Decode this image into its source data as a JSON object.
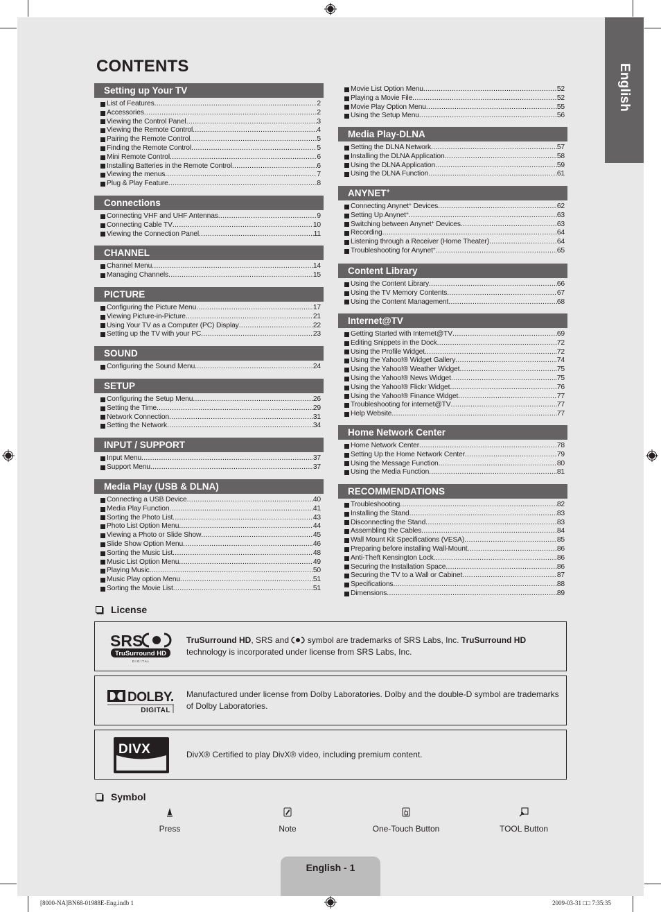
{
  "page": {
    "title": "CONTENTS",
    "language_tab": "English",
    "footer_page": "English - 1",
    "slug_left": "[8000-NA]BN68-01988E-Eng.indb   1",
    "slug_right": "2009-03-31   □□ 7:35:35"
  },
  "left_column": [
    {
      "header": "Setting up Your TV",
      "entries": [
        {
          "label": "List of Features",
          "page": "2"
        },
        {
          "label": "Accessories",
          "page": "2"
        },
        {
          "label": "Viewing the Control Panel",
          "page": "3"
        },
        {
          "label": "Viewing the Remote Control",
          "page": "4"
        },
        {
          "label": "Pairing the Remote Control",
          "page": "5"
        },
        {
          "label": "Finding the Remote Control",
          "page": "5"
        },
        {
          "label": "Mini Remote Control",
          "page": "6"
        },
        {
          "label": "Installing Batteries in the Remote Control",
          "page": "6"
        },
        {
          "label": "Viewing the menus",
          "page": "7"
        },
        {
          "label": "Plug & Play Feature",
          "page": "8"
        }
      ]
    },
    {
      "header": "Connections",
      "entries": [
        {
          "label": "Connecting VHF and UHF Antennas",
          "page": "9"
        },
        {
          "label": "Connecting Cable TV",
          "page": "10"
        },
        {
          "label": "Viewing the Connection Panel",
          "page": "11"
        }
      ]
    },
    {
      "header": "CHANNEL",
      "entries": [
        {
          "label": "Channel Menu",
          "page": "14"
        },
        {
          "label": "Managing Channels",
          "page": "15"
        }
      ]
    },
    {
      "header": "PICTURE",
      "entries": [
        {
          "label": "Configuring the Picture Menu",
          "page": "17"
        },
        {
          "label": "Viewing Picture-in-Picture",
          "page": "21"
        },
        {
          "label": "Using Your TV as a Computer (PC) Display",
          "page": "22"
        },
        {
          "label": "Setting up the TV with your PC",
          "page": "23"
        }
      ]
    },
    {
      "header": "SOUND",
      "entries": [
        {
          "label": "Configuring the Sound Menu",
          "page": "24"
        }
      ]
    },
    {
      "header": "SETUP",
      "entries": [
        {
          "label": "Configuring the Setup Menu",
          "page": "26"
        },
        {
          "label": "Setting the Time",
          "page": "29"
        },
        {
          "label": "Network Connection",
          "page": "31"
        },
        {
          "label": "Setting the Network",
          "page": "34"
        }
      ]
    },
    {
      "header": "INPUT / SUPPORT",
      "entries": [
        {
          "label": "Input Menu",
          "page": "37"
        },
        {
          "label": "Support Menu",
          "page": "37"
        }
      ]
    },
    {
      "header": "Media Play (USB & DLNA)",
      "entries": [
        {
          "label": "Connecting a USB Device",
          "page": "40"
        },
        {
          "label": "Media Play Function",
          "page": "41"
        },
        {
          "label": "Sorting the Photo List",
          "page": "43"
        },
        {
          "label": "Photo List Option Menu",
          "page": "44"
        },
        {
          "label": "Viewing a Photo or Slide Show",
          "page": "45"
        },
        {
          "label": "Slide Show Option Menu",
          "page": "46"
        },
        {
          "label": "Sorting the Music List",
          "page": "48"
        },
        {
          "label": "Music List Option Menu",
          "page": "49"
        },
        {
          "label": "Playing Music",
          "page": "50"
        },
        {
          "label": "Music Play option Menu",
          "page": "51"
        },
        {
          "label": "Sorting the Movie List",
          "page": "51"
        }
      ]
    }
  ],
  "right_column": [
    {
      "header": "",
      "entries": [
        {
          "label": "Movie List Option Menu",
          "page": "52"
        },
        {
          "label": "Playing a Movie File",
          "page": "52"
        },
        {
          "label": "Movie Play Option Menu",
          "page": "55"
        },
        {
          "label": "Using the Setup Menu",
          "page": "56"
        }
      ]
    },
    {
      "header": "Media Play-DLNA",
      "entries": [
        {
          "label": "Setting the DLNA Network",
          "page": "57"
        },
        {
          "label": "Installing the DLNA Application",
          "page": "58"
        },
        {
          "label": "Using the DLNA Application",
          "page": "59"
        },
        {
          "label": "Using the DLNA Function",
          "page": "61"
        }
      ]
    },
    {
      "header": "ANYNET+",
      "entries": [
        {
          "label": "Connecting Anynet+ Devices",
          "page": "62"
        },
        {
          "label": "Setting Up Anynet+",
          "page": "63"
        },
        {
          "label": "Switching between Anynet+ Devices",
          "page": "63"
        },
        {
          "label": "Recording",
          "page": "64"
        },
        {
          "label": "Listening through a Receiver (Home Theater)",
          "page": "64"
        },
        {
          "label": "Troubleshooting for Anynet+",
          "page": "65"
        }
      ]
    },
    {
      "header": "Content Library",
      "entries": [
        {
          "label": "Using the Content Library",
          "page": "66"
        },
        {
          "label": "Using the TV Memory Contents",
          "page": "67"
        },
        {
          "label": "Using the Content Management",
          "page": "68"
        }
      ]
    },
    {
      "header": "Internet@TV",
      "entries": [
        {
          "label": "Getting Started with Internet@TV",
          "page": "69"
        },
        {
          "label": "Editing Snippets in the Dock",
          "page": "72"
        },
        {
          "label": "Using the Profile Widget",
          "page": "72"
        },
        {
          "label": "Using the Yahoo!® Widget Gallery",
          "page": "74"
        },
        {
          "label": "Using the Yahoo!® Weather Widget",
          "page": "75"
        },
        {
          "label": "Using the Yahoo!® News Widget",
          "page": "75"
        },
        {
          "label": "Using the Yahoo!® Flickr Widget",
          "page": "76"
        },
        {
          "label": "Using the Yahoo!® Finance Widget",
          "page": "77"
        },
        {
          "label": "Troubleshooting for internet@TV",
          "page": "77"
        },
        {
          "label": "Help Website",
          "page": "77"
        }
      ]
    },
    {
      "header": "Home Network Center",
      "entries": [
        {
          "label": "Home Network Center",
          "page": "78"
        },
        {
          "label": "Setting Up the Home Network Center",
          "page": "79"
        },
        {
          "label": "Using the Message Function",
          "page": "80"
        },
        {
          "label": "Using the Media Function",
          "page": "81"
        }
      ]
    },
    {
      "header": "RECOMMENDATIONS",
      "entries": [
        {
          "label": "Troubleshooting",
          "page": "82"
        },
        {
          "label": "Installing the Stand",
          "page": "83"
        },
        {
          "label": "Disconnecting the Stand",
          "page": "83"
        },
        {
          "label": "Assembling the Cables",
          "page": "84"
        },
        {
          "label": "Wall Mount Kit Specifications (VESA)",
          "page": "85"
        },
        {
          "label": "Preparing before installing Wall-Mount",
          "page": "86"
        },
        {
          "label": "Anti-Theft Kensington Lock",
          "page": "86"
        },
        {
          "label": "Securing the Installation Space",
          "page": "86"
        },
        {
          "label": "Securing the TV to a Wall or Cabinet",
          "page": "87"
        },
        {
          "label": "Specifications",
          "page": "88"
        },
        {
          "label": "Dimensions",
          "page": "89"
        }
      ]
    }
  ],
  "license": {
    "heading": "License",
    "items": [
      {
        "logo": "srs-trusurround-hd-logo",
        "logo_text": {
          "brand": "SRS",
          "badge": "TruSurround HD",
          "sub": "D I G I T A L"
        },
        "bold_1": "TruSurround HD",
        "text_1": ", SRS and ",
        "symbol": "srs-circle-symbol",
        "text_2": " symbol are trademarks of SRS Labs, Inc. ",
        "bold_2": "TruSurround HD",
        "text_3": " technology is incorporated under license from SRS Labs, Inc."
      },
      {
        "logo": "dolby-digital-logo",
        "logo_text": {
          "brand": "DOLBY.",
          "sub": "DIGITAL"
        },
        "text": "Manufactured under license from Dolby Laboratories. Dolby and the double-D symbol are trademarks of Dolby Laboratories."
      },
      {
        "logo": "divx-logo",
        "logo_text": {
          "brand": "DIVX"
        },
        "text": "DivX® Certified to play DivX® video, including premium content."
      }
    ]
  },
  "symbols": {
    "heading": "Symbol",
    "items": [
      {
        "icon": "press-icon",
        "label": "Press"
      },
      {
        "icon": "note-icon",
        "label": "Note"
      },
      {
        "icon": "one-touch-button-icon",
        "label": "One-Touch Button"
      },
      {
        "icon": "tool-button-icon",
        "label": "TOOL Button"
      }
    ]
  },
  "colors": {
    "page_bg": "#e8e8e8",
    "header_bg": "#646262",
    "header_text": "#ffffff",
    "text": "#231f20",
    "footer_tab": "#bdbcbc"
  }
}
